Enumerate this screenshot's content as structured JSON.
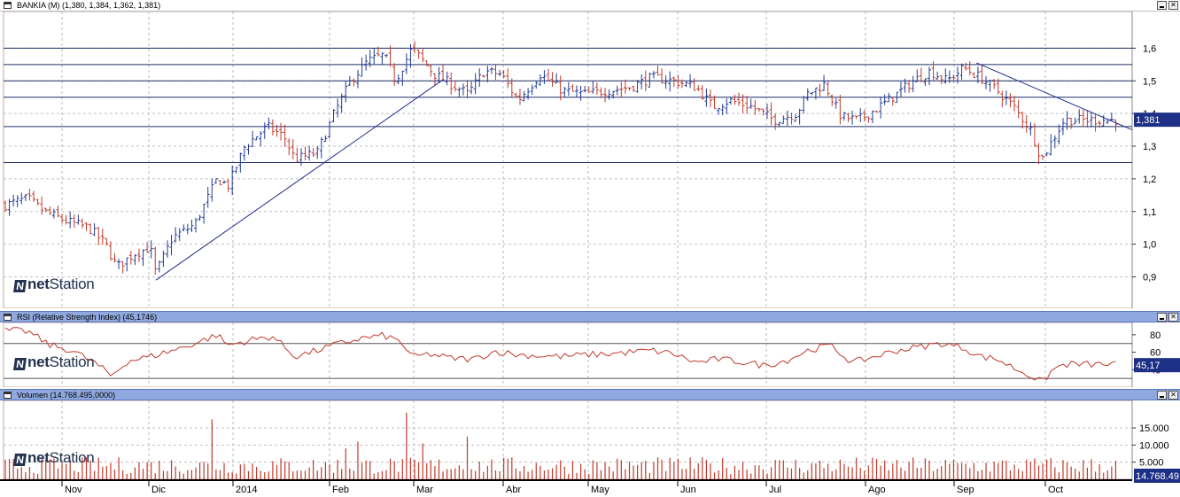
{
  "price_pane": {
    "title": "BANKIA (M) (1,380, 1,384, 1,362, 1,381)",
    "last_value_label": "1,381",
    "y_ticks": [
      "0,9",
      "1,0",
      "1,1",
      "1,2",
      "1,3",
      "1,4",
      "1,5",
      "1,6"
    ]
  },
  "rsi_pane": {
    "title": "RSI (Relative Strength Index) (45,1746)",
    "last_value_label": "45,17",
    "y_ticks": [
      "40",
      "60",
      "80"
    ]
  },
  "volume_pane": {
    "title": "Volumen (14.768.495,0000)",
    "last_value_label": "14.768.49",
    "y_ticks": [
      "5.000",
      "10.000",
      "15.000"
    ]
  },
  "x_axis": {
    "labels": [
      "Nov",
      "Dic",
      "2014",
      "Feb",
      "Mar",
      "Abr",
      "May",
      "Jun",
      "Jul",
      "Ago",
      "Sep",
      "Oct"
    ]
  },
  "watermark": {
    "text_net": "net",
    "text_station": "Station",
    "mark": "N"
  },
  "colors": {
    "up": "#1f3a93",
    "down": "#c0392b",
    "line": "#c0392b",
    "trend": "#1f2d8a",
    "label_bg": "#1e2f86"
  },
  "chart_data": [
    {
      "type": "ohlc",
      "title": "BANKIA (M) (1,380, 1,384, 1,362, 1,381)",
      "ylim": [
        0.82,
        1.62
      ],
      "horizontal_levels": [
        1.6,
        1.55,
        1.5,
        1.45,
        1.36,
        1.25
      ],
      "trendlines": [
        {
          "from": {
            "bar": 0.135,
            "value": 0.89
          },
          "to": {
            "bar": 0.39,
            "value": 1.505
          }
        },
        {
          "from": {
            "bar": 0.862,
            "value": 1.555
          },
          "to": {
            "bar": 1.0,
            "value": 1.35
          }
        }
      ],
      "anchors": [
        [
          0,
          1.12
        ],
        [
          0.02,
          1.14
        ],
        [
          0.035,
          1.1
        ],
        [
          0.055,
          1.07
        ],
        [
          0.075,
          1.05
        ],
        [
          0.09,
          1.0
        ],
        [
          0.1,
          0.93
        ],
        [
          0.115,
          0.97
        ],
        [
          0.13,
          0.99
        ],
        [
          0.135,
          0.91
        ],
        [
          0.15,
          1.02
        ],
        [
          0.17,
          1.06
        ],
        [
          0.19,
          1.2
        ],
        [
          0.2,
          1.18
        ],
        [
          0.215,
          1.3
        ],
        [
          0.235,
          1.36
        ],
        [
          0.25,
          1.33
        ],
        [
          0.26,
          1.26
        ],
        [
          0.28,
          1.28
        ],
        [
          0.295,
          1.4
        ],
        [
          0.31,
          1.5
        ],
        [
          0.325,
          1.56
        ],
        [
          0.34,
          1.58
        ],
        [
          0.35,
          1.5
        ],
        [
          0.365,
          1.6
        ],
        [
          0.375,
          1.56
        ],
        [
          0.385,
          1.52
        ],
        [
          0.4,
          1.49
        ],
        [
          0.415,
          1.46
        ],
        [
          0.43,
          1.53
        ],
        [
          0.445,
          1.52
        ],
        [
          0.46,
          1.44
        ],
        [
          0.48,
          1.52
        ],
        [
          0.5,
          1.47
        ],
        [
          0.52,
          1.46
        ],
        [
          0.54,
          1.47
        ],
        [
          0.56,
          1.48
        ],
        [
          0.58,
          1.51
        ],
        [
          0.6,
          1.5
        ],
        [
          0.62,
          1.48
        ],
        [
          0.635,
          1.42
        ],
        [
          0.65,
          1.44
        ],
        [
          0.67,
          1.42
        ],
        [
          0.69,
          1.38
        ],
        [
          0.71,
          1.4
        ],
        [
          0.72,
          1.46
        ],
        [
          0.735,
          1.49
        ],
        [
          0.75,
          1.39
        ],
        [
          0.765,
          1.38
        ],
        [
          0.78,
          1.41
        ],
        [
          0.8,
          1.46
        ],
        [
          0.815,
          1.5
        ],
        [
          0.83,
          1.53
        ],
        [
          0.845,
          1.5
        ],
        [
          0.86,
          1.54
        ],
        [
          0.875,
          1.51
        ],
        [
          0.89,
          1.47
        ],
        [
          0.905,
          1.42
        ],
        [
          0.92,
          1.35
        ],
        [
          0.93,
          1.26
        ],
        [
          0.94,
          1.32
        ],
        [
          0.95,
          1.38
        ]
      ]
    },
    {
      "type": "line",
      "title": "RSI (Relative Strength Index) (45,1746)",
      "ylim": [
        22,
        90
      ],
      "levels": [
        30,
        70
      ],
      "anchors": [
        [
          0,
          85
        ],
        [
          0.02,
          84
        ],
        [
          0.04,
          68
        ],
        [
          0.06,
          62
        ],
        [
          0.08,
          48
        ],
        [
          0.095,
          33
        ],
        [
          0.11,
          50
        ],
        [
          0.13,
          55
        ],
        [
          0.15,
          62
        ],
        [
          0.17,
          70
        ],
        [
          0.19,
          80
        ],
        [
          0.2,
          68
        ],
        [
          0.22,
          74
        ],
        [
          0.24,
          78
        ],
        [
          0.26,
          55
        ],
        [
          0.28,
          62
        ],
        [
          0.3,
          70
        ],
        [
          0.32,
          76
        ],
        [
          0.34,
          79
        ],
        [
          0.355,
          72
        ],
        [
          0.365,
          54
        ],
        [
          0.38,
          58
        ],
        [
          0.4,
          53
        ],
        [
          0.42,
          52
        ],
        [
          0.44,
          61
        ],
        [
          0.46,
          57
        ],
        [
          0.48,
          56
        ],
        [
          0.5,
          55
        ],
        [
          0.52,
          57
        ],
        [
          0.54,
          58
        ],
        [
          0.56,
          60
        ],
        [
          0.58,
          62
        ],
        [
          0.6,
          58
        ],
        [
          0.62,
          48
        ],
        [
          0.64,
          52
        ],
        [
          0.66,
          49
        ],
        [
          0.68,
          45
        ],
        [
          0.7,
          50
        ],
        [
          0.72,
          62
        ],
        [
          0.74,
          68
        ],
        [
          0.76,
          48
        ],
        [
          0.78,
          55
        ],
        [
          0.8,
          62
        ],
        [
          0.82,
          66
        ],
        [
          0.84,
          70
        ],
        [
          0.86,
          65
        ],
        [
          0.875,
          55
        ],
        [
          0.89,
          52
        ],
        [
          0.905,
          42
        ],
        [
          0.92,
          33
        ],
        [
          0.93,
          25
        ],
        [
          0.94,
          40
        ],
        [
          0.95,
          46
        ]
      ]
    },
    {
      "type": "bar",
      "title": "Volumen (14.768.495,0000)",
      "ylim": [
        0,
        22000
      ],
      "spikes": [
        {
          "bar": 0.185,
          "value": 17500
        },
        {
          "bar": 0.359,
          "value": 19500
        },
        {
          "bar": 0.315,
          "value": 11000
        },
        {
          "bar": 0.414,
          "value": 12500
        },
        {
          "bar": 0.305,
          "value": 9000
        },
        {
          "bar": 0.373,
          "value": 10500
        }
      ],
      "typical_range": [
        1500,
        6500
      ]
    }
  ]
}
